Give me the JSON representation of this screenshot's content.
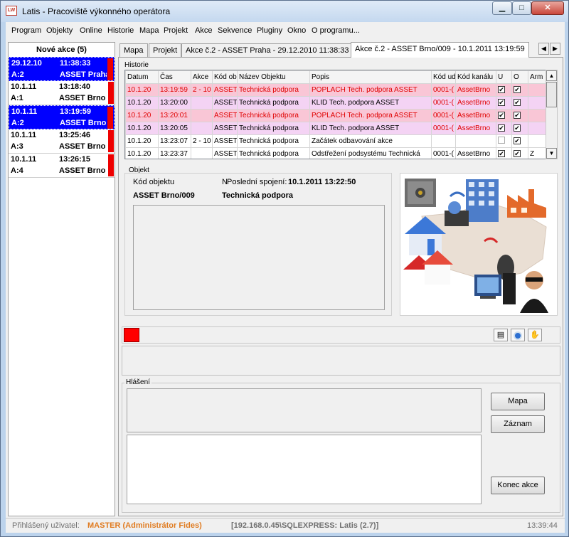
{
  "window": {
    "app_icon": "LW",
    "title": "Latis - Pracoviště výkonného operátora",
    "min": "▁",
    "max": "□",
    "close": "✕"
  },
  "menu": [
    "Program",
    "Objekty",
    "Online",
    "Historie",
    "Mapa",
    "Projekt",
    "Akce",
    "Sekvence",
    "Pluginy",
    "Okno",
    "O programu..."
  ],
  "new_actions": {
    "header": "Nové akce (5)",
    "items": [
      {
        "date": "29.12.10",
        "time": "11:38:33",
        "action": "A:2",
        "object": "ASSET Praha",
        "selected": true
      },
      {
        "date": "10.1.11",
        "time": "13:18:40",
        "action": "A:1",
        "object": "ASSET Brno",
        "selected": false
      },
      {
        "date": "10.1.11",
        "time": "13:19:59",
        "action": "A:2",
        "object": "ASSET Brno",
        "selected": true
      },
      {
        "date": "10.1.11",
        "time": "13:25:46",
        "action": "A:3",
        "object": "ASSET Brno",
        "selected": false
      },
      {
        "date": "10.1.11",
        "time": "13:26:15",
        "action": "A:4",
        "object": "ASSET Brno",
        "selected": false
      }
    ]
  },
  "tabs": [
    "Mapa",
    "Projekt",
    "Akce č.2 - ASSET Praha - 29.12.2010 11:38:33",
    "Akce č.2 - ASSET Brno/009 - 10.1.2011 13:19:59"
  ],
  "tab_nav": [
    "◀",
    "▶"
  ],
  "history": {
    "label": "Historie",
    "columns": [
      "Datum",
      "Čas",
      "Akce",
      "Kód ob",
      "Název Objektu",
      "Popis",
      "Kód ud",
      "Kód kanálu",
      "U",
      "O",
      "Arm"
    ],
    "rows": [
      {
        "style": "pink",
        "datum": "10.1.20",
        "cas": "13:19:59",
        "akce": "2 - 10",
        "kod": "ASSET",
        "nazev": "Technická podpora",
        "popis": "POPLACH Tech. podpora ASSET",
        "kodud": "0001-(",
        "kanal": "AssetBrno",
        "u": true,
        "o": true,
        "arm": ""
      },
      {
        "style": "lav",
        "datum": "10.1.20",
        "cas": "13:20:00",
        "akce": "",
        "kod": "ASSET",
        "nazev": "Technická podpora",
        "popis": "KLID Tech. podpora ASSET",
        "kodud": "0001-(",
        "kanal": "AssetBrno",
        "u": true,
        "o": true,
        "arm": ""
      },
      {
        "style": "pink",
        "datum": "10.1.20",
        "cas": "13:20:01",
        "akce": "",
        "kod": "ASSET",
        "nazev": "Technická podpora",
        "popis": "POPLACH Tech. podpora ASSET",
        "kodud": "0001-(",
        "kanal": "AssetBrno",
        "u": true,
        "o": true,
        "arm": ""
      },
      {
        "style": "lav",
        "datum": "10.1.20",
        "cas": "13:20:05",
        "akce": "",
        "kod": "ASSET",
        "nazev": "Technická podpora",
        "popis": "KLID Tech. podpora ASSET",
        "kodud": "0001-(",
        "kanal": "AssetBrno",
        "u": true,
        "o": true,
        "arm": ""
      },
      {
        "style": "white",
        "datum": "10.1.20",
        "cas": "13:23:07",
        "akce": "2 - 10",
        "kod": "ASSET",
        "nazev": "Technická podpora",
        "popis": "Začátek odbavování akce",
        "kodud": "",
        "kanal": "",
        "u": false,
        "o": true,
        "arm": ""
      },
      {
        "style": "white",
        "datum": "10.1.20",
        "cas": "13:23:37",
        "akce": "",
        "kod": "ASSET",
        "nazev": "Technická podpora",
        "popis": "Odstřežení podsystému Technická",
        "kodud": "0001-(",
        "kanal": "AssetBrno",
        "u": true,
        "o": true,
        "arm": "Z"
      }
    ]
  },
  "object": {
    "label": "Objekt",
    "code_label": "Kód objektu",
    "code_value": "ASSET Brno/009",
    "name_label": "N",
    "last_conn_label": "Poslední spojení:",
    "last_conn_value": "10.1.2011 13:22:50",
    "name_value": "Technická podpora"
  },
  "status_color": "#ff0000",
  "toolbar_icons": [
    "report-icon",
    "record-icon",
    "handshake-icon"
  ],
  "report": {
    "label": "Hlášení",
    "map_button": "Mapa",
    "record_button": "Záznam",
    "end_button": "Konec akce"
  },
  "statusbar": {
    "user_label": "Přihlášený uživatel:",
    "user_value": "MASTER (Administrátor Fides)",
    "db": "[192.168.0.45\\SQLEXPRESS: Latis (2.7)]",
    "time": "13:39:44"
  }
}
